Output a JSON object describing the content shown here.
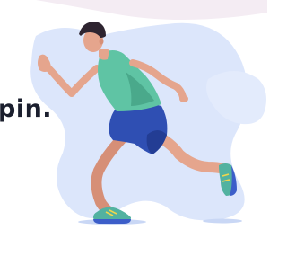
{
  "headline": {
    "visible_fragment": "pin."
  },
  "illustration": {
    "subject": "running-man",
    "colors": {
      "blob": "#dce6fb",
      "blob_light": "#e9effd",
      "shadow": "#c9d7f5",
      "band": "#f4ecf3",
      "skin": "#e5a58d",
      "skin_shade": "#d68f77",
      "hair": "#2e2430",
      "tank_top": "#5fc4a4",
      "tank_shade": "#4aa98b",
      "shorts": "#2f4fb3",
      "shorts_shade": "#233d94",
      "shoe": "#52b2a0",
      "shoe_accent": "#f2d64b",
      "sole": "#3c5ec9",
      "text": "#1b1f2e"
    }
  }
}
